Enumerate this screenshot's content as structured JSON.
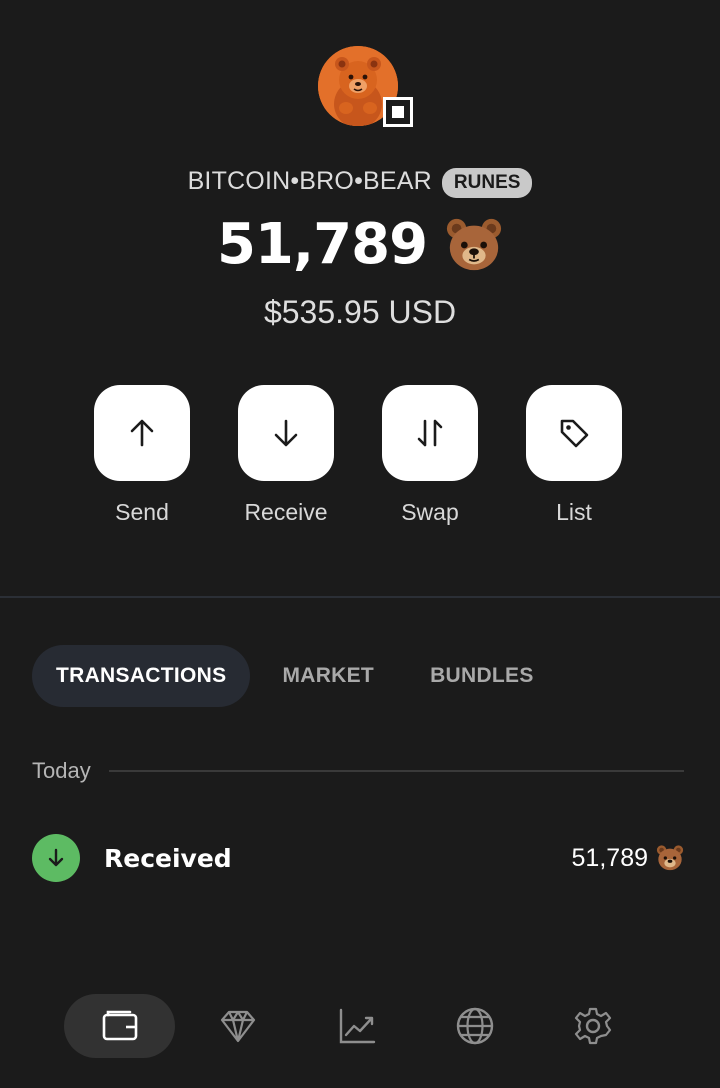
{
  "token": {
    "name": "BITCOIN•BRO•BEAR",
    "badge": "RUNES",
    "balance": "51,789",
    "symbol_icon": "bear-emoji-icon",
    "usd_value": "$535.95 USD",
    "avatar_icon": "bear-plush-avatar",
    "chain_icon": "ordinals-chain-icon"
  },
  "actions": [
    {
      "label": "Send",
      "icon": "arrow-up-icon"
    },
    {
      "label": "Receive",
      "icon": "arrow-down-icon"
    },
    {
      "label": "Swap",
      "icon": "swap-arrows-icon"
    },
    {
      "label": "List",
      "icon": "tag-icon"
    }
  ],
  "tabs": [
    {
      "label": "TRANSACTIONS",
      "active": true
    },
    {
      "label": "MARKET",
      "active": false
    },
    {
      "label": "BUNDLES",
      "active": false
    }
  ],
  "transactions": {
    "section_label": "Today",
    "items": [
      {
        "label": "Received",
        "amount": "51,789",
        "icon": "arrow-down-icon",
        "status_color": "#5dbb63"
      }
    ]
  },
  "bottom_nav": [
    {
      "icon": "wallet-icon",
      "active": true
    },
    {
      "icon": "diamond-icon",
      "active": false
    },
    {
      "icon": "chart-icon",
      "active": false
    },
    {
      "icon": "globe-icon",
      "active": false
    },
    {
      "icon": "gear-icon",
      "active": false
    }
  ],
  "colors": {
    "background": "#1b1b1b",
    "accent_green": "#5dbb63",
    "tab_active_bg": "#272b33",
    "nav_active_bg": "#323232"
  }
}
